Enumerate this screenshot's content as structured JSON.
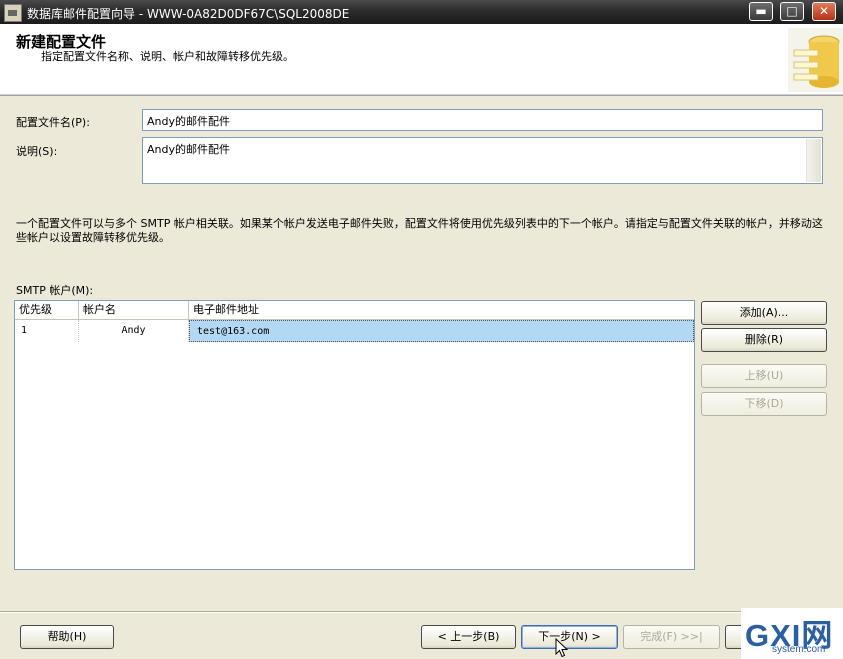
{
  "window": {
    "title": "数据库邮件配置向导 - WWW-0A82D0DF67C\\SQL2008DE",
    "minimize_glyph": "▬",
    "maximize_glyph": "□",
    "close_glyph": "✕"
  },
  "header": {
    "title": "新建配置文件",
    "subtitle": "指定配置文件名称、说明、帐户和故障转移优先级。",
    "logo_icon": "database-mail-icon"
  },
  "form": {
    "profile_name_label": "配置文件名(P):",
    "profile_name_value": "Andy的邮件配件",
    "description_label": "说明(S):",
    "description_value": "Andy的邮件配件"
  },
  "info_text": "一个配置文件可以与多个 SMTP 帐户相关联。如果某个帐户发送电子邮件失败，配置文件将使用优先级列表中的下一个帐户。请指定与配置文件关联的帐户，并移动这些帐户以设置故障转移优先级。",
  "smtp": {
    "label": "SMTP 帐户(M):",
    "columns": [
      "优先级",
      "帐户名",
      "电子邮件地址"
    ],
    "rows": [
      {
        "priority": "1",
        "account": "Andy",
        "email": "test@163.com"
      }
    ]
  },
  "side_buttons": {
    "add": "添加(A)...",
    "remove": "删除(R)",
    "move_up": "上移(U)",
    "move_down": "下移(D)"
  },
  "footer": {
    "help": "帮助(H)",
    "back": "< 上一步(B)",
    "next": "下一步(N) >",
    "finish": "完成(F) >>|"
  },
  "watermark": {
    "main": "GXI网",
    "sub": "system.com"
  },
  "colors": {
    "selection": "#b3d8f4",
    "titlebar": "#2b2b2b",
    "dialog": "#ece9d8"
  }
}
